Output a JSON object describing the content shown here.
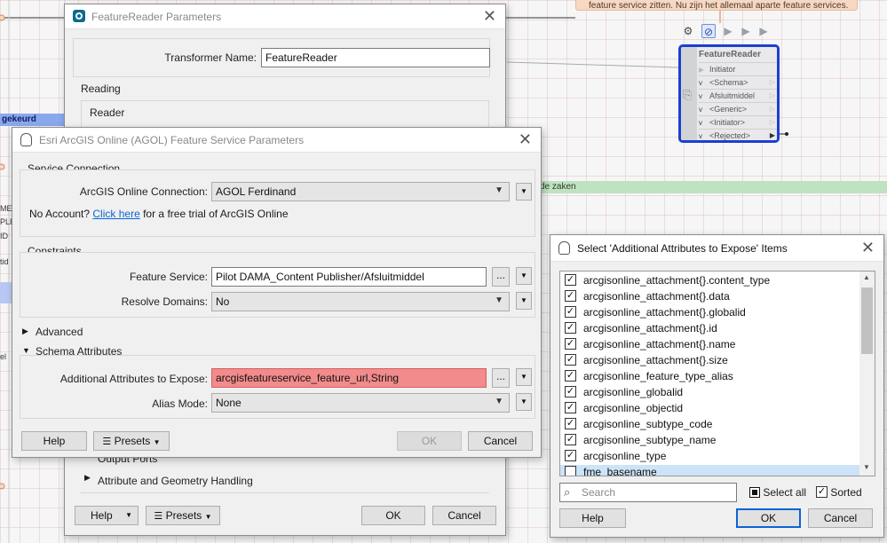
{
  "canvas": {
    "note_text": "feature service zitten. Nu zijn het allemaal aparte feature services.",
    "green_band_label": "de zaken",
    "blue_band_label": "gekeurd",
    "left_fragments": [
      "ME",
      "PLE",
      "ID",
      "tid",
      "el"
    ]
  },
  "node": {
    "title": "FeatureReader",
    "input_port": "Initiator",
    "output_ports": [
      "<Schema>",
      "Afsluitmiddel",
      "<Generic>",
      "<Initiator>",
      "<Rejected>"
    ]
  },
  "fr_dialog": {
    "title": "FeatureReader Parameters",
    "transformer_name_label": "Transformer Name:",
    "transformer_name_value": "FeatureReader",
    "reading_label": "Reading",
    "reader_label": "Reader",
    "output_ports_label": "Output Ports",
    "attr_geom_label": "Attribute and Geometry Handling",
    "help_label": "Help",
    "presets_label": "Presets",
    "ok_label": "OK",
    "cancel_label": "Cancel"
  },
  "agol_dialog": {
    "title": "Esri ArcGIS Online (AGOL) Feature Service Parameters",
    "service_connection_label": "Service Connection",
    "connection_label": "ArcGIS Online Connection:",
    "connection_value": "AGOL Ferdinand",
    "no_account_text": "No Account?",
    "click_here_text": "Click here",
    "free_trial_text": "for a free trial of ArcGIS Online",
    "constraints_label": "Constraints",
    "feature_service_label": "Feature Service:",
    "feature_service_value": "Pilot DAMA_Content Publisher/Afsluitmiddel",
    "ellipsis_label": "...",
    "resolve_domains_label": "Resolve Domains:",
    "resolve_domains_value": "No",
    "advanced_label": "Advanced",
    "schema_attributes_label": "Schema Attributes",
    "additional_attrs_label": "Additional Attributes to Expose:",
    "additional_attrs_value": "arcgisfeatureservice_feature_url,String",
    "alias_mode_label": "Alias Mode:",
    "alias_mode_value": "None",
    "help_label": "Help",
    "presets_label": "Presets",
    "ok_label": "OK",
    "cancel_label": "Cancel"
  },
  "select_dialog": {
    "title": "Select 'Additional Attributes to Expose' Items",
    "items": [
      {
        "label": "arcgisonline_attachment{}.content_type",
        "checked": true
      },
      {
        "label": "arcgisonline_attachment{}.data",
        "checked": true
      },
      {
        "label": "arcgisonline_attachment{}.globalid",
        "checked": true
      },
      {
        "label": "arcgisonline_attachment{}.id",
        "checked": true
      },
      {
        "label": "arcgisonline_attachment{}.name",
        "checked": true
      },
      {
        "label": "arcgisonline_attachment{}.size",
        "checked": true
      },
      {
        "label": "arcgisonline_feature_type_alias",
        "checked": true
      },
      {
        "label": "arcgisonline_globalid",
        "checked": true
      },
      {
        "label": "arcgisonline_objectid",
        "checked": true
      },
      {
        "label": "arcgisonline_subtype_code",
        "checked": true
      },
      {
        "label": "arcgisonline_subtype_name",
        "checked": true
      },
      {
        "label": "arcgisonline_type",
        "checked": true
      },
      {
        "label": "fme_basename",
        "checked": false
      }
    ],
    "search_placeholder": "Search",
    "select_all_label": "Select all",
    "sorted_label": "Sorted",
    "help_label": "Help",
    "ok_label": "OK",
    "cancel_label": "Cancel"
  }
}
